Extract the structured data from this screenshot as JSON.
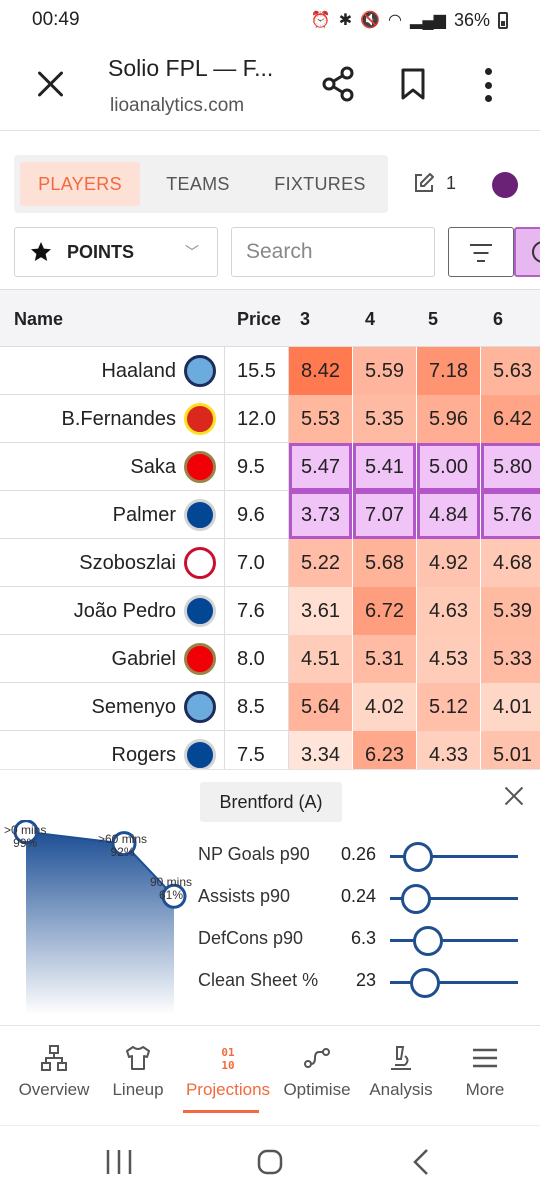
{
  "status": {
    "time": "00:49",
    "battery": "36%"
  },
  "browser": {
    "title": "Solio FPL — F...",
    "url": "lioanalytics.com"
  },
  "tabs": [
    {
      "label": "PLAYERS",
      "active": true
    },
    {
      "label": "TEAMS",
      "active": false
    },
    {
      "label": "FIXTURES",
      "active": false
    }
  ],
  "edit_count": "1",
  "points_select": {
    "label": "POINTS"
  },
  "search": {
    "placeholder": "Search"
  },
  "table": {
    "headers": {
      "name": "Name",
      "price": "Price",
      "gws": [
        "3",
        "4",
        "5",
        "6"
      ]
    },
    "rows": [
      {
        "name": "Haaland",
        "club": "MCI",
        "price": "15.5",
        "values": [
          "8.42",
          "5.59",
          "7.18",
          "5.63"
        ],
        "highlight": false
      },
      {
        "name": "B.Fernandes",
        "club": "MUN",
        "price": "12.0",
        "values": [
          "5.53",
          "5.35",
          "5.96",
          "6.42"
        ],
        "highlight": false
      },
      {
        "name": "Saka",
        "club": "ARS",
        "price": "9.5",
        "values": [
          "5.47",
          "5.41",
          "5.00",
          "5.80"
        ],
        "highlight": true
      },
      {
        "name": "Palmer",
        "club": "CHE",
        "price": "9.6",
        "values": [
          "3.73",
          "7.07",
          "4.84",
          "5.76"
        ],
        "highlight": true
      },
      {
        "name": "Szoboszlai",
        "club": "LIV",
        "price": "7.0",
        "values": [
          "5.22",
          "5.68",
          "4.92",
          "4.68"
        ],
        "highlight": false
      },
      {
        "name": "João Pedro",
        "club": "CHE",
        "price": "7.6",
        "values": [
          "3.61",
          "6.72",
          "4.63",
          "5.39"
        ],
        "highlight": false
      },
      {
        "name": "Gabriel",
        "club": "ARS",
        "price": "8.0",
        "values": [
          "4.51",
          "5.31",
          "4.53",
          "5.33"
        ],
        "highlight": false
      },
      {
        "name": "Semenyo",
        "club": "MCI",
        "price": "8.5",
        "values": [
          "5.64",
          "4.02",
          "5.12",
          "4.01"
        ],
        "highlight": false
      },
      {
        "name": "Rogers",
        "club": "CHE",
        "price": "7.5",
        "values": [
          "3.34",
          "6.23",
          "4.33",
          "5.01"
        ],
        "highlight": false
      }
    ]
  },
  "panel": {
    "opponent": "Brentford (A)",
    "minutes": [
      {
        "label": ">0 mins",
        "pct": "99%"
      },
      {
        "label": ">60 mins",
        "pct": "92%"
      },
      {
        "label": "90 mins",
        "pct": "61%"
      }
    ],
    "stats": [
      {
        "name": "NP Goals p90",
        "value": "0.26",
        "level": 0.22
      },
      {
        "name": "Assists p90",
        "value": "0.24",
        "level": 0.2
      },
      {
        "name": "DefCons p90",
        "value": "6.3",
        "level": 0.3
      },
      {
        "name": "Clean Sheet %",
        "value": "23",
        "level": 0.27
      }
    ]
  },
  "nav": [
    {
      "label": "Overview",
      "icon": "sitemap-icon",
      "active": false
    },
    {
      "label": "Lineup",
      "icon": "shirt-icon",
      "active": false
    },
    {
      "label": "Projections",
      "icon": "binary-icon",
      "active": true
    },
    {
      "label": "Optimise",
      "icon": "route-icon",
      "active": false
    },
    {
      "label": "Analysis",
      "icon": "microscope-icon",
      "active": false
    },
    {
      "label": "More",
      "icon": "hamburger-icon",
      "active": false
    }
  ],
  "colors": {
    "accent": "#f26a3d",
    "highlight": "#b356c9",
    "highlight_fill": "#f1c4f7",
    "slider": "#1f4f8f"
  }
}
